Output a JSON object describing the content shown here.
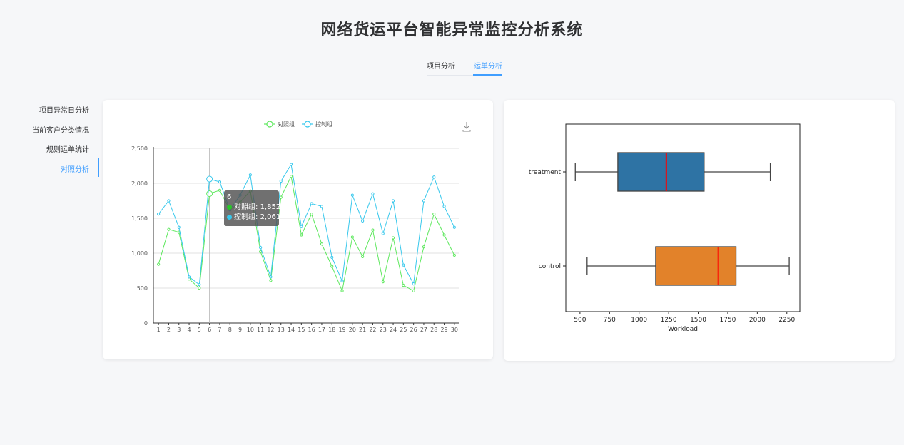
{
  "app_title": "网络货运平台智能异常监控分析系统",
  "top_tabs": [
    {
      "label": "项目分析",
      "active": false
    },
    {
      "label": "运单分析",
      "active": true
    }
  ],
  "sidebar": {
    "items": [
      {
        "label": "项目异常日分析"
      },
      {
        "label": "当前客户分类情况"
      },
      {
        "label": "规则运单统计"
      },
      {
        "label": "对照分析",
        "active": true
      }
    ]
  },
  "colors": {
    "accent": "#409eff",
    "series_control_group": "#5ee85e",
    "series_experiment_group": "#38c8ec",
    "box_treatment": "#2e73a4",
    "box_control": "#e2822a",
    "median": "#ff0000"
  },
  "left_chart": {
    "download_icon": "download-icon",
    "tooltip": {
      "title": "6",
      "rows": [
        {
          "label": "对照组",
          "value": "1,852",
          "color": "#28c828"
        },
        {
          "label": "控制组",
          "value": "2,061",
          "color": "#38c8ec"
        }
      ]
    }
  },
  "chart_data": [
    {
      "type": "line",
      "x": [
        "1",
        "2",
        "3",
        "4",
        "5",
        "6",
        "7",
        "8",
        "9",
        "10",
        "11",
        "12",
        "13",
        "14",
        "15",
        "16",
        "17",
        "18",
        "19",
        "20",
        "21",
        "22",
        "23",
        "24",
        "25",
        "26",
        "27",
        "28",
        "29",
        "30"
      ],
      "series": [
        {
          "name": "对照组",
          "values": [
            840,
            1340,
            1300,
            630,
            500,
            1852,
            1900,
            1620,
            1730,
            1890,
            1020,
            610,
            1800,
            2100,
            1260,
            1560,
            1130,
            810,
            460,
            1230,
            950,
            1330,
            590,
            1220,
            540,
            460,
            1090,
            1560,
            1260,
            970
          ]
        },
        {
          "name": "控制组",
          "values": [
            1560,
            1750,
            1370,
            660,
            550,
            2061,
            2020,
            1620,
            1830,
            2120,
            1080,
            660,
            2030,
            2270,
            1380,
            1710,
            1670,
            940,
            600,
            1830,
            1460,
            1850,
            1280,
            1750,
            830,
            560,
            1750,
            2090,
            1670,
            1370
          ]
        }
      ],
      "y_ticks": [
        "0",
        "500",
        "1,000",
        "1,500",
        "2,000",
        "2,500"
      ],
      "ylim": [
        0,
        2500
      ],
      "legend_position": "top-center",
      "grid": true,
      "highlight_index": 5
    },
    {
      "type": "box",
      "orientation": "horizontal",
      "categories": [
        "treatment",
        "control"
      ],
      "boxes": [
        {
          "name": "treatment",
          "whislo": 460,
          "q1": 820,
          "med": 1230,
          "q3": 1550,
          "whishi": 2110
        },
        {
          "name": "control",
          "whislo": 560,
          "q1": 1140,
          "med": 1670,
          "q3": 1820,
          "whishi": 2270
        }
      ],
      "xlabel": "Workload",
      "x_ticks": [
        "500",
        "750",
        "1000",
        "1250",
        "1500",
        "1750",
        "2000",
        "2250"
      ],
      "xlim": [
        380,
        2360
      ],
      "grid": false
    }
  ]
}
